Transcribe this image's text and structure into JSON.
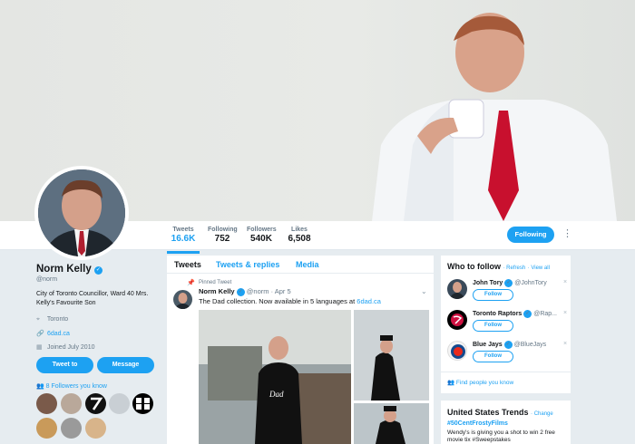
{
  "profile": {
    "name": "Norm Kelly",
    "handle": "@norm",
    "bio": "City of Toronto Councillor, Ward 40 Mrs. Kelly's Favourite Son",
    "location": "Toronto",
    "website": "6dad.ca",
    "joined": "Joined July 2010",
    "tweet_to_label": "Tweet to",
    "message_label": "Message",
    "followers_you_know": "8 Followers you know"
  },
  "stats": {
    "tweets_label": "Tweets",
    "tweets_value": "16.6K",
    "following_label": "Following",
    "following_value": "752",
    "followers_label": "Followers",
    "followers_value": "540K",
    "likes_label": "Likes",
    "likes_value": "6,508"
  },
  "header_actions": {
    "following_label": "Following",
    "more_icon": "more-dots-icon"
  },
  "timeline": {
    "tabs": [
      "Tweets",
      "Tweets & replies",
      "Media"
    ],
    "pinned_label": "Pinned Tweet",
    "tweet": {
      "name": "Norm Kelly",
      "meta": "@norm · Apr 5",
      "text": "The Dad collection. Now available in 5 languages at ",
      "link": "6dad.ca",
      "shirt_text": "Dad"
    }
  },
  "who_to_follow": {
    "title": "Who to follow",
    "refresh": "· Refresh",
    "view_all": "· View all",
    "follow_label": "Follow",
    "items": [
      {
        "name": "John Tory",
        "handle": "@JohnTory"
      },
      {
        "name": "Toronto Raptors",
        "handle": "@Rap..."
      },
      {
        "name": "Blue Jays",
        "handle": "@BlueJays"
      }
    ],
    "find_people": "Find people you know"
  },
  "trends": {
    "title": "United States Trends",
    "change": "· Change",
    "tag": "#50CentFrostyFilms",
    "desc": "Wendy's is giving you a shot to win 2 free movie tix #Sweepstakes"
  },
  "colors": {
    "accent": "#1da1f2",
    "page_bg": "#e6ecf0",
    "tie_red": "#c8102e"
  }
}
